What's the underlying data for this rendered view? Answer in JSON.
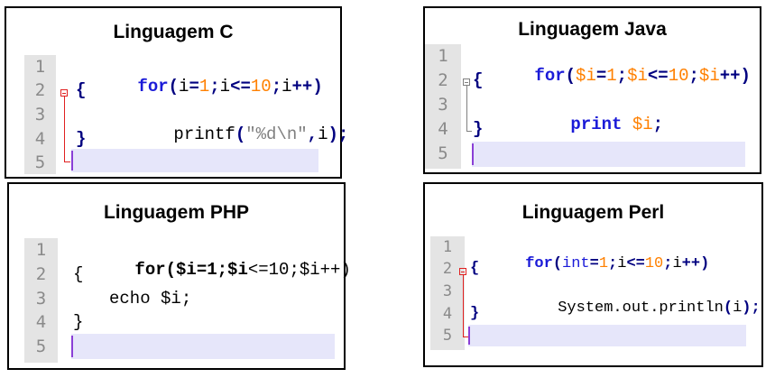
{
  "panels": {
    "c": {
      "title": "Linguagem C",
      "line_numbers": [
        "1",
        "2",
        "3",
        "4",
        "5"
      ],
      "code": {
        "l1": [
          "for",
          "(",
          "i",
          "=",
          "1",
          ";",
          "i",
          "<=",
          "10",
          ";",
          "i",
          "++",
          ")"
        ],
        "l2": "{",
        "l3": [
          "printf",
          "(",
          "\"%d\\n\"",
          ",",
          "i",
          ")",
          ";"
        ],
        "l4": "}"
      }
    },
    "java": {
      "title": "Linguagem Java",
      "line_numbers": [
        "1",
        "2",
        "3",
        "4",
        "5"
      ],
      "code": {
        "l1": [
          "for",
          "(",
          "$i",
          "=",
          "1",
          ";",
          "$i",
          "<=",
          "10",
          ";",
          "$i",
          "++",
          ")"
        ],
        "l2": "{",
        "l3": [
          "print",
          " ",
          "$i",
          ";"
        ],
        "l4": "}"
      }
    },
    "php": {
      "title": "Linguagem PHP",
      "line_numbers": [
        "1",
        "2",
        "3",
        "4",
        "5"
      ],
      "code": {
        "l1": [
          "for($i=1;$i",
          "<=10;$i++)"
        ],
        "l2": "{",
        "l3": "echo $i;",
        "l4": "}"
      }
    },
    "perl": {
      "title": "Linguagem Perl",
      "line_numbers": [
        "1",
        "2",
        "3",
        "4",
        "5"
      ],
      "code": {
        "l1": [
          "for",
          "(",
          "int",
          "=",
          "1",
          ";",
          "i",
          "<=",
          "10",
          ";",
          "i",
          "++",
          ")"
        ],
        "l2": "{",
        "l3": [
          "System.out.println",
          "(",
          "i",
          ")",
          ";"
        ],
        "l4": "}"
      }
    }
  },
  "colors": {
    "keyword": "#1b1bd8",
    "number": "#ff8000",
    "variable": "#ff8000",
    "string": "#808080",
    "fold_c": "#e02020",
    "fold_java": "#808080",
    "highlight": "#e6e6fa",
    "cursor": "#8a3fd6"
  }
}
